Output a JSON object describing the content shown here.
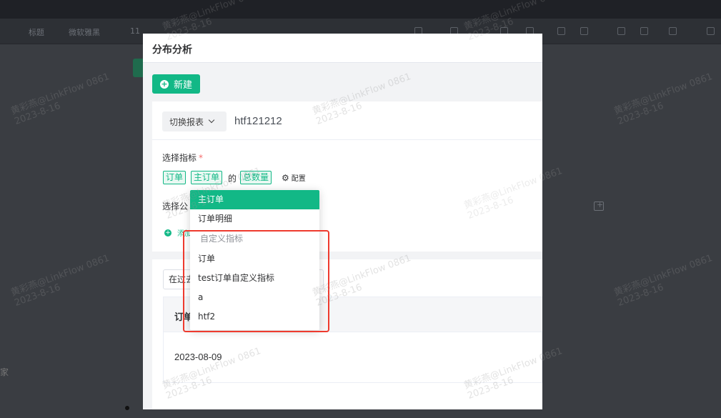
{
  "background": {
    "toolbar_items": [
      "标题",
      "微软雅黑",
      "11"
    ],
    "left_text": "家"
  },
  "modal": {
    "title": "分布分析",
    "new_button": "新建",
    "switch_report": "切换报表",
    "report_name": "htf121212",
    "select_metric_label": "选择指标",
    "required_mark": "*",
    "metric_tags": [
      "订单",
      "主订单",
      "总数量"
    ],
    "connector": "的",
    "config_label": "配置",
    "select_formula_label": "选择公",
    "add_label": "添加",
    "time_range": "在过去",
    "table_header": "订单",
    "table_rows": [
      "2023-08-09"
    ]
  },
  "dropdown": {
    "items": [
      {
        "label": "主订单",
        "selected": true
      },
      {
        "label": "订单明细",
        "selected": false
      }
    ],
    "group_label": "自定义指标",
    "group_items": [
      "订单",
      "test订单自定义指标",
      "a",
      "htf2"
    ]
  },
  "watermark": {
    "line1": "黄彩燕@LinkFlow 0861",
    "line2": "2023-8-16"
  },
  "colors": {
    "accent": "#12b886",
    "highlight_box": "#ee3a2e"
  }
}
